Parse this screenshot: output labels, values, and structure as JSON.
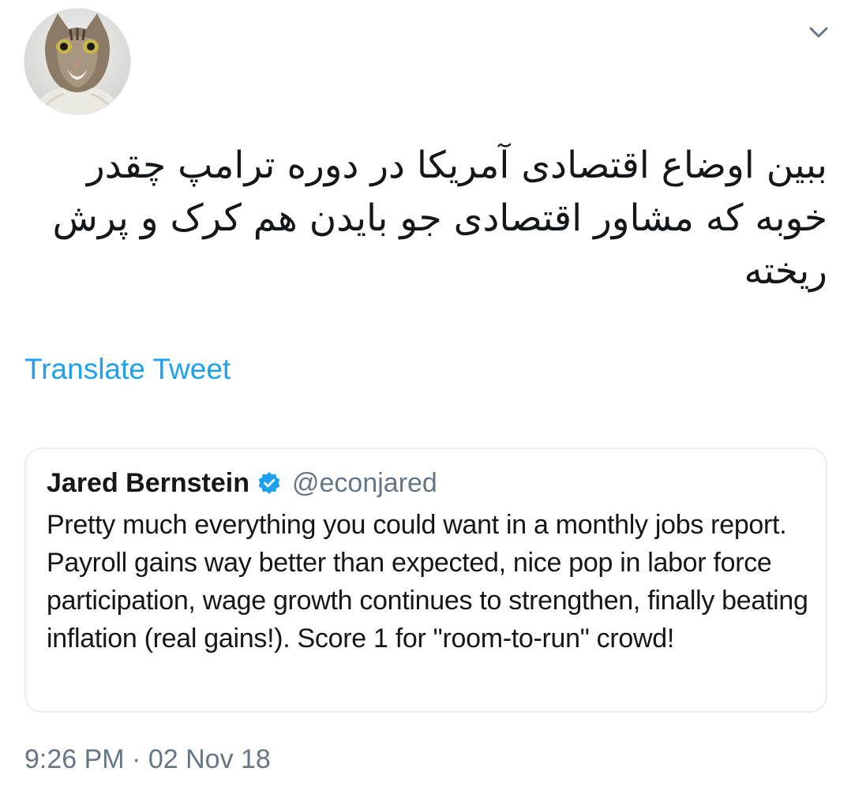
{
  "tweet": {
    "avatar_icon": "cat-avatar",
    "caret_icon": "chevron-down-icon",
    "text": "ببین اوضاع اقتصادی آمریکا در دوره ترامپ چقدر خوبه که مشاور اقتصادی جو بایدن هم کرک و پرش ریخته",
    "translate_label": "Translate Tweet",
    "timestamp": "9:26 PM · 02 Nov 18"
  },
  "quoted_tweet": {
    "name": "Jared Bernstein",
    "verified_icon": "verified-badge-icon",
    "handle": "@econjared",
    "text": "Pretty much everything you could want in a monthly jobs report. Payroll gains way better than expected, nice pop in labor force participation, wage growth continues to strengthen, finally beating inflation (real gains!). Score 1 for \"room-to-run\" crowd!"
  },
  "colors": {
    "link": "#1da1f2",
    "secondary_text": "#657786",
    "border": "#e6ecf0",
    "verified": "#1da1f2"
  }
}
